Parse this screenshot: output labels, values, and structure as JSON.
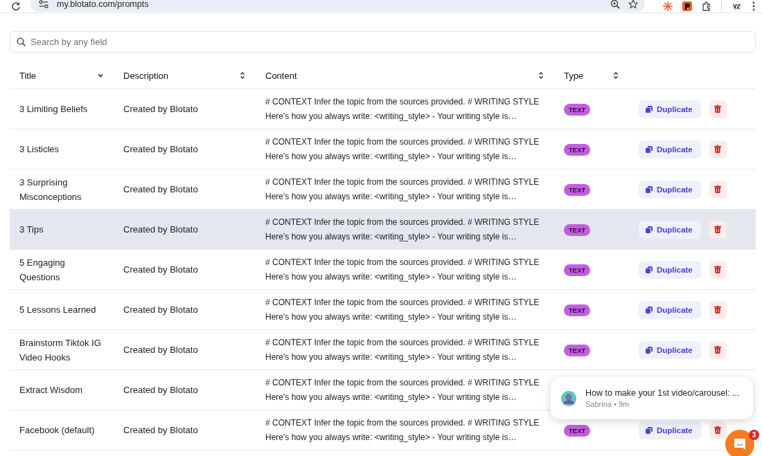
{
  "browser": {
    "url": "my.blotato.com/prompts"
  },
  "search": {
    "placeholder": "Search by any field"
  },
  "table": {
    "columns": [
      {
        "label": "Title",
        "sorted": true
      },
      {
        "label": "Description",
        "sorted": false
      },
      {
        "label": "Content",
        "sorted": false
      },
      {
        "label": "Type",
        "sorted": false
      }
    ],
    "rows": [
      {
        "title": "3 Limiting Beliefs",
        "description": "Created by Blotato",
        "content": "# CONTEXT Infer the topic from the sources provided. # WRITING STYLE\nHere's how you always write: <writing_style> - Your writing style is…",
        "type": "TEXT",
        "highlighted": false,
        "action": "Duplicate"
      },
      {
        "title": "3 Listicles",
        "description": "Created by Blotato",
        "content": "# CONTEXT Infer the topic from the sources provided. # WRITING STYLE\nHere's how you always write: <writing_style> - Your writing style is…",
        "type": "TEXT",
        "highlighted": false,
        "action": "Duplicate"
      },
      {
        "title": "3 Surprising Misconceptions",
        "description": "Created by Blotato",
        "content": "# CONTEXT Infer the topic from the sources provided. # WRITING STYLE\nHere's how you always write: <writing_style> - Your writing style is…",
        "type": "TEXT",
        "highlighted": false,
        "action": "Duplicate"
      },
      {
        "title": "3 Tips",
        "description": "Created by Blotato",
        "content": "# CONTEXT Infer the topic from the sources provided. # WRITING STYLE\nHere's how you always write: <writing_style> - Your writing style is…",
        "type": "TEXT",
        "highlighted": true,
        "action": "Duplicate"
      },
      {
        "title": "5 Engaging Questions",
        "description": "Created by Blotato",
        "content": "# CONTEXT Infer the topic from the sources provided. # WRITING STYLE\nHere's how you always write: <writing_style> - Your writing style is…",
        "type": "TEXT",
        "highlighted": false,
        "action": "Duplicate"
      },
      {
        "title": "5 Lessons Learned",
        "description": "Created by Blotato",
        "content": "# CONTEXT Infer the topic from the sources provided. # WRITING STYLE\nHere's how you always write: <writing_style> - Your writing style is…",
        "type": "TEXT",
        "highlighted": false,
        "action": "Duplicate"
      },
      {
        "title": "Brainstorm Tiktok IG Video Hooks",
        "description": "Created by Blotato",
        "content": "# CONTEXT Infer the topic from the sources provided. # WRITING STYLE\nHere's how you always write: <writing_style> - Your writing style is…",
        "type": "TEXT",
        "highlighted": false,
        "action": "Duplicate"
      },
      {
        "title": "Extract Wisdom",
        "description": "Created by Blotato",
        "content": "# CONTEXT Infer the topic from the sources provided. # WRITING STYLE\nHere's how you always write: <writing_style> - Your writing style is…",
        "highlighted": false
      },
      {
        "title": "Facebook (default)",
        "description": "Created by Blotato",
        "content": "# CONTEXT Infer the topic from the sources provided. # WRITING STYLE\nHere's how you always write: <writing_style> - Your writing style is…",
        "type": "TEXT",
        "highlighted": false,
        "action": "Duplicate"
      }
    ]
  },
  "chat": {
    "message": "How to make your 1st video/carousel: ...",
    "meta": "Sabrina • 9m",
    "unread": "3"
  }
}
